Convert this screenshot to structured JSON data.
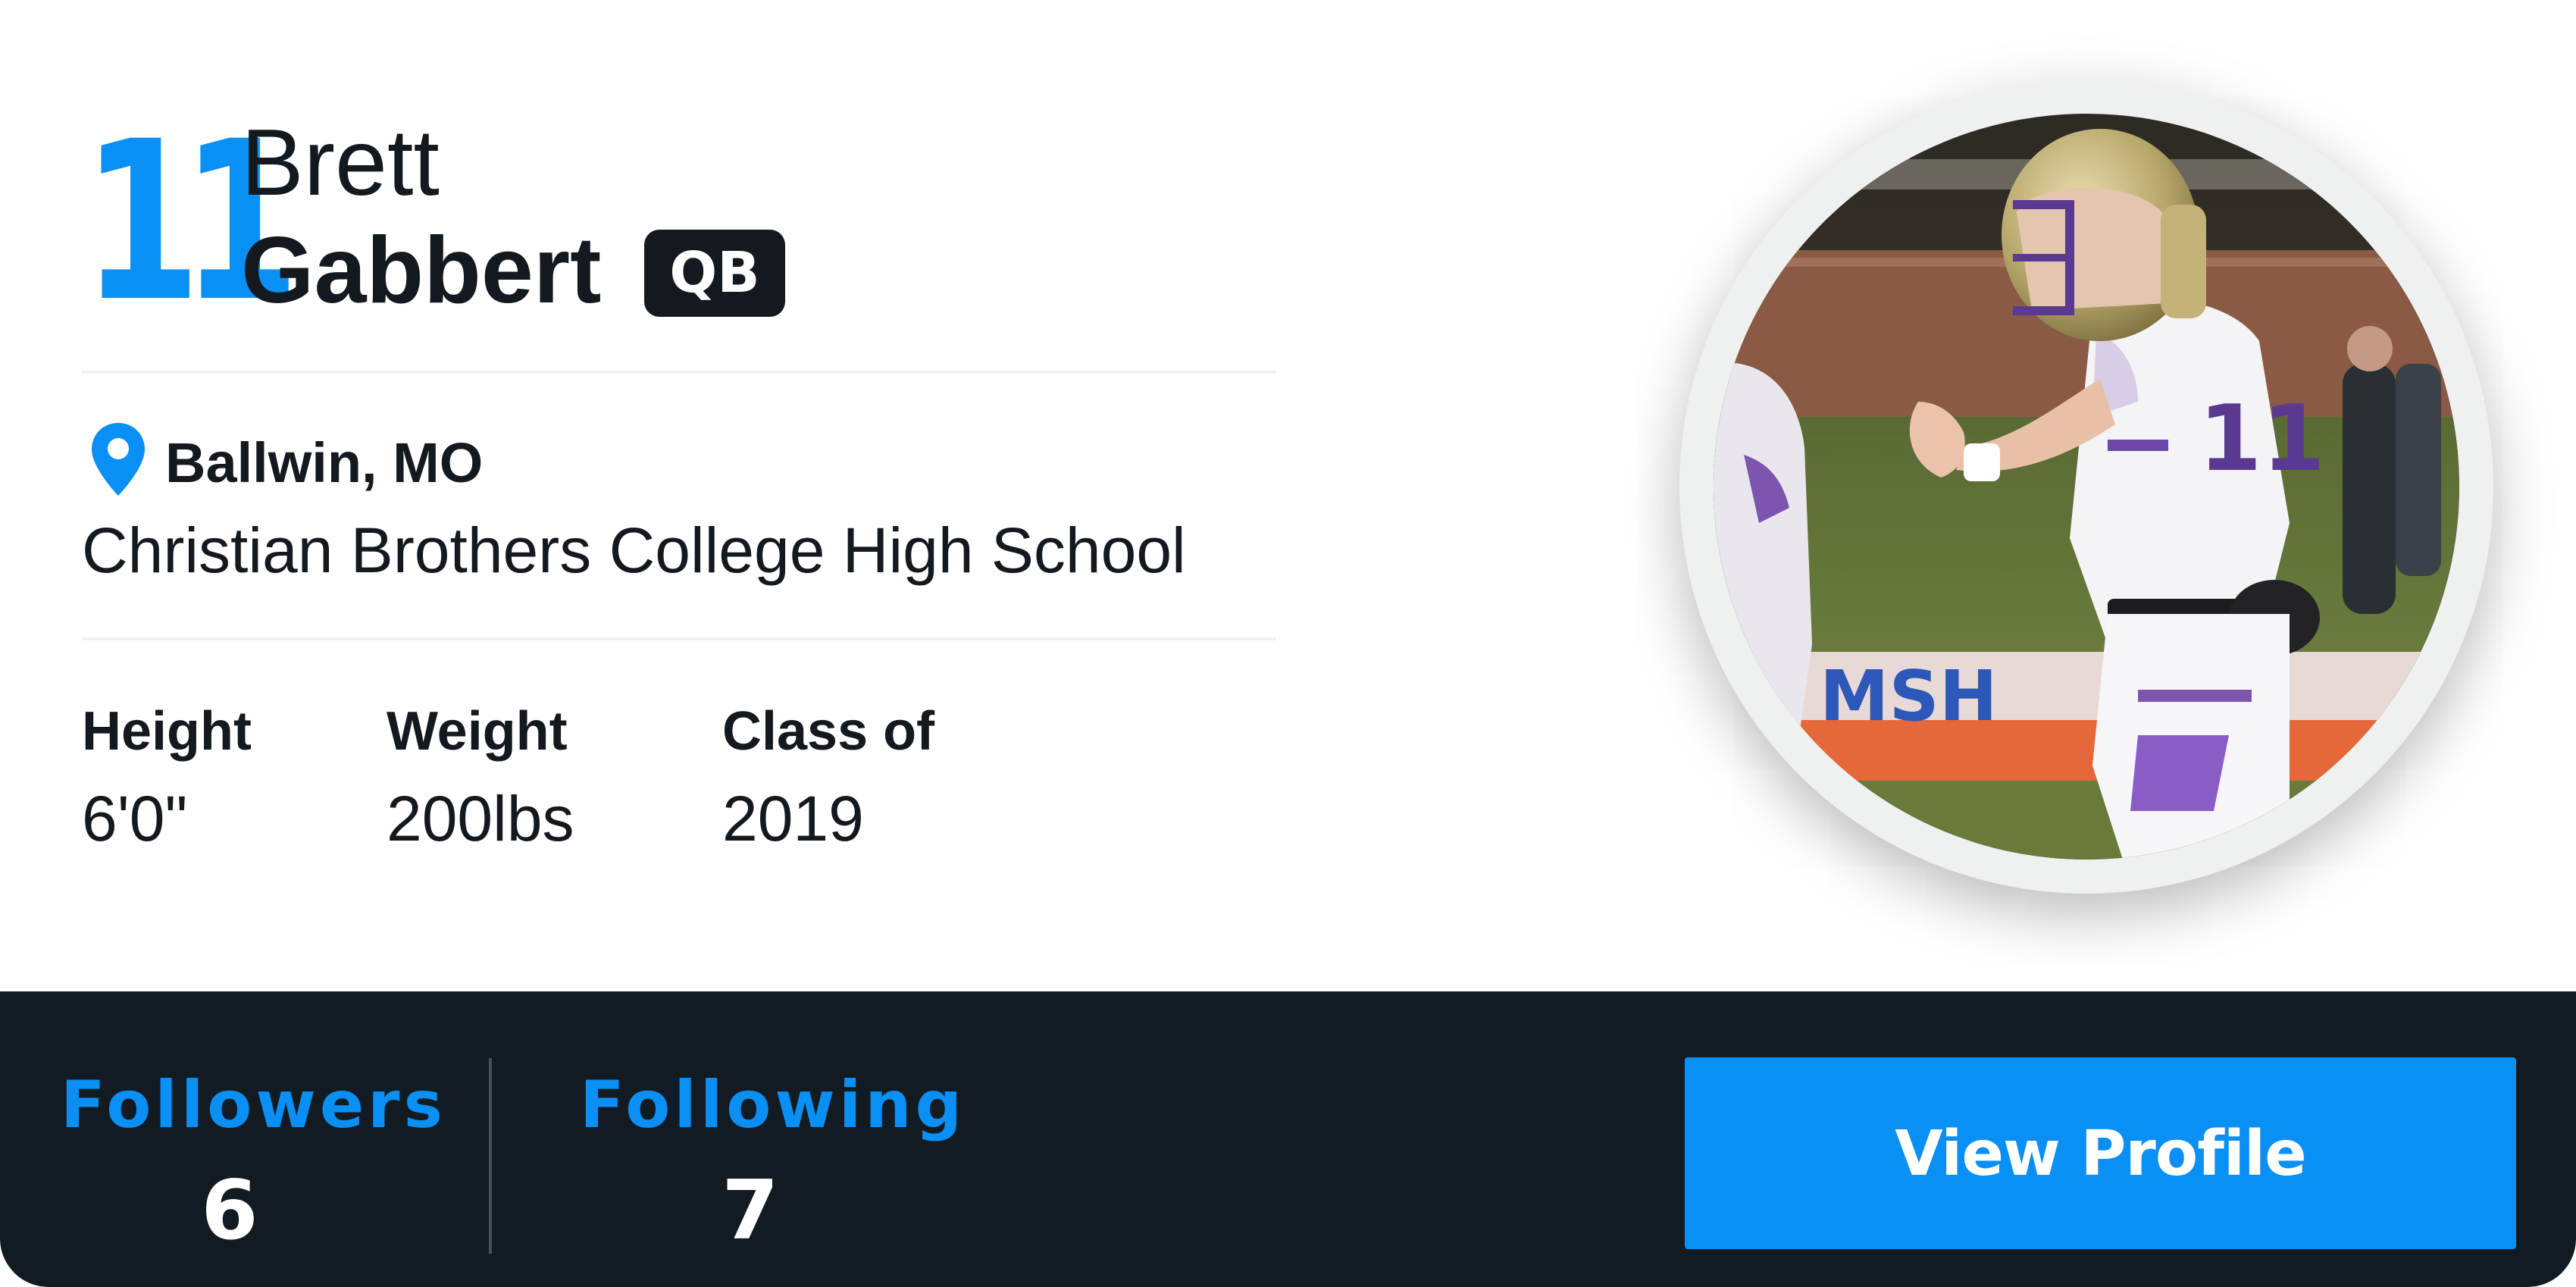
{
  "player": {
    "number": "11",
    "first_name": "Brett",
    "last_name": "Gabbert",
    "position": "QB",
    "location": "Ballwin, MO",
    "school": "Christian Brothers College High School"
  },
  "stats": {
    "height_label": "Height",
    "height_value": "6'0\"",
    "weight_label": "Weight",
    "weight_value": "200lbs",
    "class_label": "Class of",
    "class_value": "2019"
  },
  "photo": {
    "banner_text": "MSH"
  },
  "bottom": {
    "followers_label": "Followers",
    "followers_count": "6",
    "following_label": "Following",
    "following_count": "7",
    "view_profile_label": "View Profile"
  },
  "icons": {
    "location": "map-pin-icon"
  },
  "colors": {
    "accent": "#0a8ff5",
    "dark": "#14191f",
    "bar": "#131b22"
  }
}
